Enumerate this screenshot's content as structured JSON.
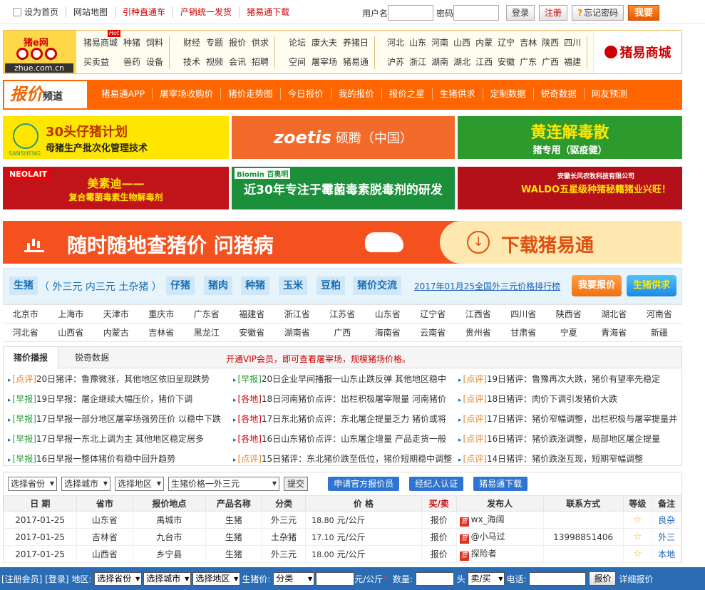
{
  "topbar": {
    "links": [
      "设为首页",
      "网站地图",
      "引种直通车",
      "产销统一发货",
      "猪易通下载"
    ],
    "username_label": "用户名",
    "password_label": "密码",
    "login": "登录",
    "register": "注册",
    "forgot": "忘记密码",
    "report": "我要"
  },
  "logo": {
    "name": "猪e网",
    "domain": "zhue.com.cn"
  },
  "nav": {
    "hot": "Hot",
    "group1": [
      "猪易商城",
      "种猪",
      "饲料",
      "买卖益",
      "兽药",
      "设备"
    ],
    "group2": [
      "财经",
      "专题",
      "报价",
      "供求",
      "技术",
      "视频",
      "会讯",
      "招聘"
    ],
    "group3": [
      "论坛",
      "康大夫",
      "养猪日",
      "空间",
      "屠宰场",
      "猪易通"
    ],
    "group4": [
      "河北",
      "山东",
      "河南",
      "山西",
      "内蒙",
      "辽宁",
      "吉林",
      "陕西",
      "四川",
      "沪苏",
      "浙江",
      "湖南",
      "湖北",
      "江西",
      "安徽",
      "广东",
      "广西",
      "福建"
    ],
    "shop": "猪易商城"
  },
  "pricebar": {
    "logo": "报价",
    "logo_sub": "频道",
    "items": [
      "猪易通APP",
      "屠宰场收购价",
      "猪价走势图",
      "今日报价",
      "我的报价",
      "报价之星",
      "生猪供求",
      "定制数据",
      "锐奇数据",
      "网友预测"
    ]
  },
  "ads": {
    "ad1_title": "30头仔猪计划",
    "ad1_sub": "母猪生产批次化管理技术",
    "ad1_brand": "SANSHENG",
    "ad2_title": "zoetis",
    "ad2_cn": "硕腾（中国）",
    "ad3_title": "黄连解毒散",
    "ad3_sub": "猪专用（驱疫健）",
    "ad4_brand": "NEOLAIT",
    "ad4_title": "美素迪——",
    "ad4_sub": "复合霉菌毒素生物解毒剂",
    "ad5_brand": "Biomin 百奥明",
    "ad5_title": "近30年专注于霉菌毒素脱毒剂的研发",
    "ad6_brand": "安徽长风农牧科技有限公司",
    "ad6_title": "WALDO五星级种猪秘籍猪业兴旺！"
  },
  "banner": {
    "slogan": "随时随地查猪价  问猪病",
    "download": "下载猪易通"
  },
  "catbar": {
    "main": "生猪",
    "sub": "（ 外三元  内三元  土杂猪 ）",
    "cats": [
      "仔猪",
      "猪肉",
      "种猪",
      "玉米",
      "豆粕",
      "猪价交流"
    ],
    "rank_link": "2017年01月25全国外三元价格排行榜",
    "btn_report": "我要报价",
    "btn_supply": "生猪供求"
  },
  "regions": {
    "row1": [
      "北京市",
      "上海市",
      "天津市",
      "重庆市",
      "广东省",
      "福建省",
      "浙江省",
      "江苏省",
      "山东省",
      "辽宁省",
      "江西省",
      "四川省",
      "陕西省",
      "湖北省",
      "河南省"
    ],
    "row2": [
      "河北省",
      "山西省",
      "内蒙古",
      "吉林省",
      "黑龙江",
      "安徽省",
      "湖南省",
      "广西",
      "海南省",
      "云南省",
      "贵州省",
      "甘肃省",
      "宁夏",
      "青海省",
      "新疆"
    ]
  },
  "news": {
    "tab_active": "猪价播报",
    "tab_other": "锐奇数据",
    "notice": "开通VIP会员，即可查看屠宰场，规模猪场价格。",
    "items": [
      {
        "cat": "[点评]",
        "text": "20日猪评：鲁豫微涨，其他地区依旧呈现跌势"
      },
      {
        "cat": "[早报]",
        "text": "20日企业早间播报一山东止跌反弹 其他地区稳中"
      },
      {
        "cat": "[点评]",
        "text": "19日猪评：鲁豫再次大跌，猪价有望率先稳定"
      },
      {
        "cat": "[早报]",
        "text": "19日早报：屠企继续大幅压价，猪价下调"
      },
      {
        "cat": "[各地]",
        "text": "18日河南猪价点评：出栏积极屠宰限量 河南猪价"
      },
      {
        "cat": "[点评]",
        "text": "18日猪评：肉价下调引发猪价大跌"
      },
      {
        "cat": "[早报]",
        "text": "17日早报一部分地区屠宰场强势压价 以稳中下跌"
      },
      {
        "cat": "[各地]",
        "text": "17日东北猪价点评：东北屠企提量乏力 猪价或将"
      },
      {
        "cat": "[点评]",
        "text": "17日猪评：猪价窄幅调整，出栏积极与屠宰提量并"
      },
      {
        "cat": "[早报]",
        "text": "17日早报一东北上调为主 其他地区稳定居多"
      },
      {
        "cat": "[各地]",
        "text": "16日山东猪价点评：山东屠企增量 产品走货一般"
      },
      {
        "cat": "[点评]",
        "text": "16日猪评：猪价跌涨调整，局部地区屠企提量"
      },
      {
        "cat": "[早报]",
        "text": "16日早报一整体猪价有稳中回升趋势"
      },
      {
        "cat": "[点评]",
        "text": "15日猪评：东北猪价跌至低位，猪价短期稳中调整"
      },
      {
        "cat": "[点评]",
        "text": "14日猪评：猪价跌涨互现，短期窄幅调整"
      }
    ]
  },
  "filters": {
    "province": "选择省份",
    "city": "选择城市",
    "district": "选择地区",
    "type": "生猪价格一外三元",
    "submit": "提交",
    "b1": "申请官方报价员",
    "b2": "经纪人认证",
    "b3": "猪易通下载"
  },
  "table": {
    "headers": [
      "日 期",
      "省市",
      "报价地点",
      "产品名称",
      "分类",
      "价 格",
      "买/卖",
      "发布人",
      "联系方式",
      "等级",
      "备注"
    ],
    "rows": [
      {
        "date": "2017-01-25",
        "prov": "山东省",
        "place": "禹城市",
        "product": "生猪",
        "cls": "外三元",
        "price": "18.80",
        "unit": "元/公斤",
        "trade": "报价",
        "pub": "wx_海阔",
        "contact": "",
        "note": "良杂"
      },
      {
        "date": "2017-01-25",
        "prov": "吉林省",
        "place": "九台市",
        "product": "生猪",
        "cls": "土杂猪",
        "price": "17.10",
        "unit": "元/公斤",
        "trade": "报价",
        "pub": "@小马过",
        "contact": "13998851406",
        "note": "外三"
      },
      {
        "date": "2017-01-25",
        "prov": "山西省",
        "place": "乡宁县",
        "product": "生猪",
        "cls": "外三元",
        "price": "18.00",
        "unit": "元/公斤",
        "trade": "报价",
        "pub": "探险者",
        "contact": "",
        "note": "本地"
      }
    ],
    "badge": "官"
  },
  "bottombar": {
    "reg": "[注册会员]",
    "login": "[登录]",
    "area": "地区:",
    "province": "选择省份",
    "city": "选择城市",
    "district": "选择地区",
    "price_label": "生猪价:",
    "cls": "分类",
    "unit": "元/公斤",
    "qty": "数量:",
    "head": "头",
    "trade": "卖/买",
    "phone": "电话:",
    "submit": "报价",
    "detail": "详细报价"
  }
}
